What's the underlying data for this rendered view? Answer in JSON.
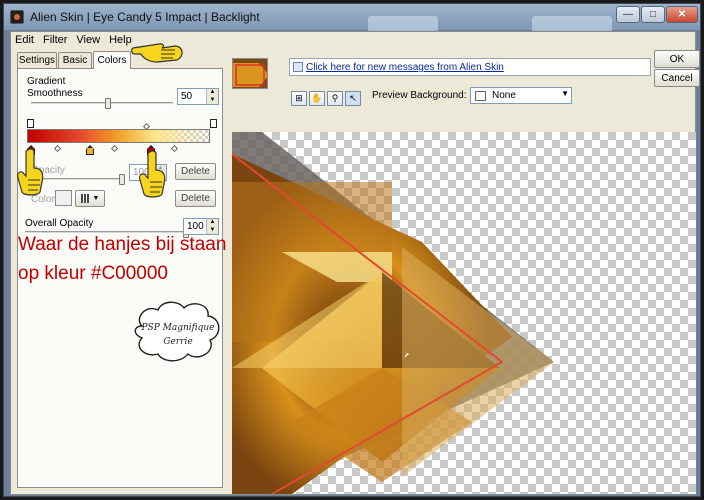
{
  "window": {
    "title": "Alien Skin | Eye Candy 5 Impact | Backlight",
    "controls": {
      "minimize": "—",
      "maximize": "□",
      "close": "✕"
    }
  },
  "menu": [
    "Edit",
    "Filter",
    "View",
    "Help"
  ],
  "tabs": [
    "Settings",
    "Basic",
    "Colors"
  ],
  "colors_panel": {
    "gradient_label": "Gradient",
    "smoothness_label": "Smoothness",
    "smoothness_value": "50",
    "smoothness_level": 0.5,
    "opacity_label": "Opacity",
    "opacity_value": "100",
    "color_label": "Color",
    "delete_label": "Delete",
    "overall_opacity_label": "Overall Opacity",
    "overall_opacity_value": "100",
    "overall_opacity_level": 1.0,
    "gradient_stop_colors": [
      "#c00000",
      "#f0b030",
      "#c00000"
    ]
  },
  "preview": {
    "message_link": "Click here for new messages from Alien Skin",
    "background_label": "Preview Background:",
    "background_value": "None"
  },
  "buttons": {
    "ok": "OK",
    "cancel": "Cancel"
  },
  "annotation": {
    "line1": "Waar de hanjes bij staan",
    "line2": "op kleur #C00000"
  },
  "watermark": {
    "line1": "PSP Magnifique",
    "line2": "Gerrie"
  },
  "icons": {
    "app": "eye-candy-app-icon",
    "pointer_hand": "pointing-hand-icon",
    "tools": [
      "zoom-fit-icon",
      "hand-tool-icon",
      "zoom-tool-icon",
      "select-arrow-icon"
    ]
  },
  "colors": {
    "accent_red": "#c00000",
    "panel_bg": "#ece9d8",
    "title_bar": "#8aa2be"
  }
}
